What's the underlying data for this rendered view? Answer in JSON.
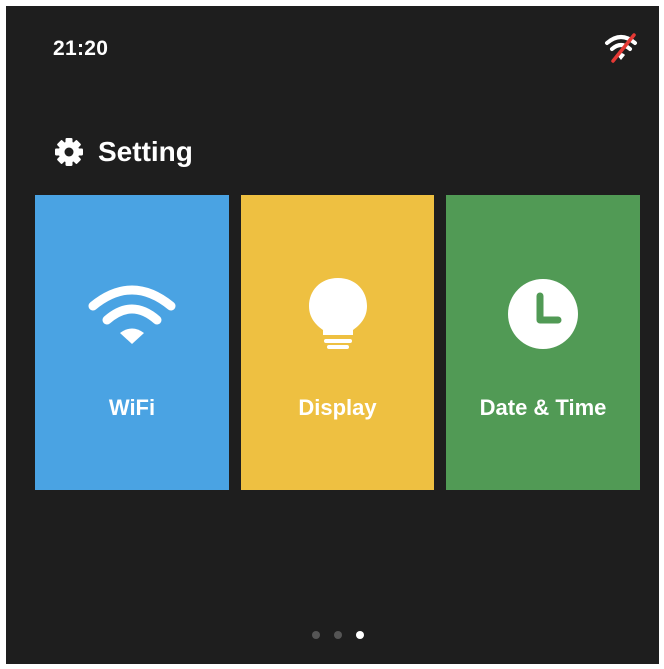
{
  "status_bar": {
    "time": "21:20",
    "wifi_icon": "wifi-off-icon"
  },
  "header": {
    "icon": "gear-icon",
    "title": "Setting"
  },
  "tiles": [
    {
      "label": "WiFi",
      "icon": "wifi-icon",
      "color": "#4aa3e3"
    },
    {
      "label": "Display",
      "icon": "lightbulb-icon",
      "color": "#eec041"
    },
    {
      "label": "Date & Time",
      "icon": "clock-icon",
      "color": "#519a55"
    }
  ],
  "pagination": {
    "pages": 3,
    "active_page": 3
  },
  "colors": {
    "background": "#1e1e1e",
    "text": "#ffffff",
    "dot_inactive": "#555555",
    "dot_active": "#ffffff",
    "wifi_off_slash": "#e53935"
  }
}
